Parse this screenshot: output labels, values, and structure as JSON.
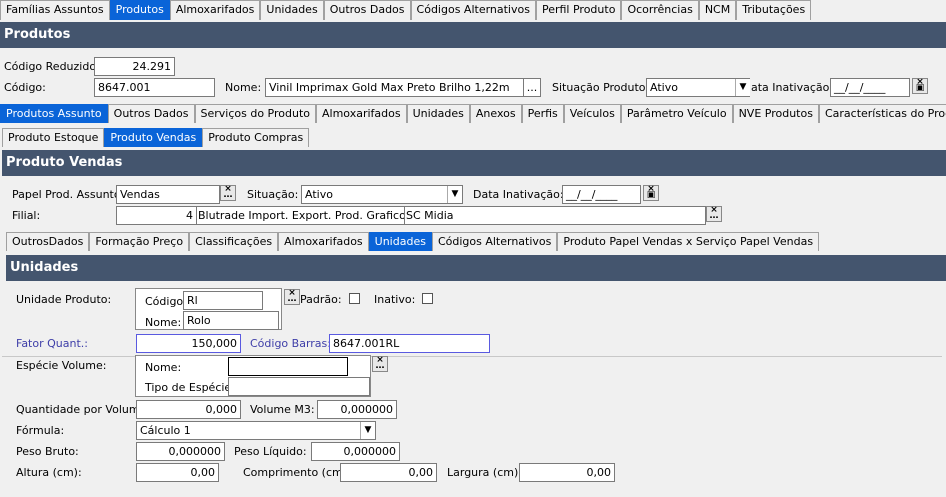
{
  "top_tabs": [
    "Famílias Assuntos",
    "Produtos",
    "Almoxarifados",
    "Unidades",
    "Outros Dados",
    "Códigos Alternativos",
    "Perfil Produto",
    "Ocorrências",
    "NCM",
    "Tributações"
  ],
  "header1": "Produtos",
  "codigo_reduzido": {
    "label": "Código Reduzido:",
    "value": "24.291"
  },
  "codigo": {
    "label": "Código:",
    "value": "8647.001"
  },
  "nome": {
    "label": "Nome:",
    "value": "Vinil Imprimax Gold Max Preto Brilho 1,22m",
    "btn": "..."
  },
  "situacao_produto": {
    "label": "Situação Produto:",
    "value": "Ativo"
  },
  "data_inativacao": {
    "label": "ata Inativação:",
    "value": "__/__/____"
  },
  "sub_tabs": [
    "Produtos Assunto",
    "Outros Dados",
    "Serviços do Produto",
    "Almoxarifados",
    "Unidades",
    "Anexos",
    "Perfis",
    "Veículos",
    "Parâmetro Veículo",
    "NVE Produtos",
    "Características do Produto"
  ],
  "sub_tabs2": [
    "Produto Estoque",
    "Produto Vendas",
    "Produto Compras"
  ],
  "header2": "Produto Vendas",
  "papel": {
    "label": "Papel Prod. Assunto:",
    "value": "Vendas"
  },
  "situacao": {
    "label": "Situação:",
    "value": "Ativo"
  },
  "data_inat2": {
    "label": "Data Inativação:",
    "value": "__/__/____"
  },
  "filial": {
    "label": "Filial:",
    "num": "4",
    "name": "Blutrade Import. Export. Prod. Graficos Ltda",
    "city": "SC Midia"
  },
  "tabs3": [
    "OutrosDados",
    "Formação Preço",
    "Classificações",
    "Almoxarifados",
    "Unidades",
    "Códigos Alternativos",
    "Produto Papel Vendas x Serviço Papel Vendas"
  ],
  "header3": "Unidades",
  "unidade_produto": {
    "label": "Unidade Produto:",
    "codigo_label": "Código:",
    "codigo": "Rl",
    "nome_label": "Nome:",
    "nome": "Rolo",
    "padrao": "Padrão:",
    "inativo": "Inativo:"
  },
  "fator": {
    "label": "Fator Quant.:",
    "value": "150,000"
  },
  "codigo_barras": {
    "label": "Código Barras:",
    "value": "8647.001RL"
  },
  "especie": {
    "label": "Espécie Volume:",
    "nome_label": "Nome:",
    "nome": "",
    "tipo_label": "Tipo de Espécie:",
    "tipo": ""
  },
  "qtd_volume": {
    "label": "Quantidade por Volume:",
    "value": "0,000"
  },
  "volume_m3": {
    "label": "Volume M3:",
    "value": "0,000000"
  },
  "formula": {
    "label": "Fórmula:",
    "value": "Cálculo 1"
  },
  "peso_bruto": {
    "label": "Peso Bruto:",
    "value": "0,000000"
  },
  "peso_liquido": {
    "label": "Peso Líquido:",
    "value": "0,000000"
  },
  "altura": {
    "label": "Altura (cm):",
    "value": "0,00"
  },
  "comprimento": {
    "label": "Comprimento (cm):",
    "value": "0,00"
  },
  "largura": {
    "label": "Largura (cm):",
    "value": "0,00"
  },
  "icons": {
    "clear": "x-icon",
    "more": "ellipsis-icon",
    "dropdown": "chevron-down-icon",
    "calendar": "calendar-icon"
  }
}
